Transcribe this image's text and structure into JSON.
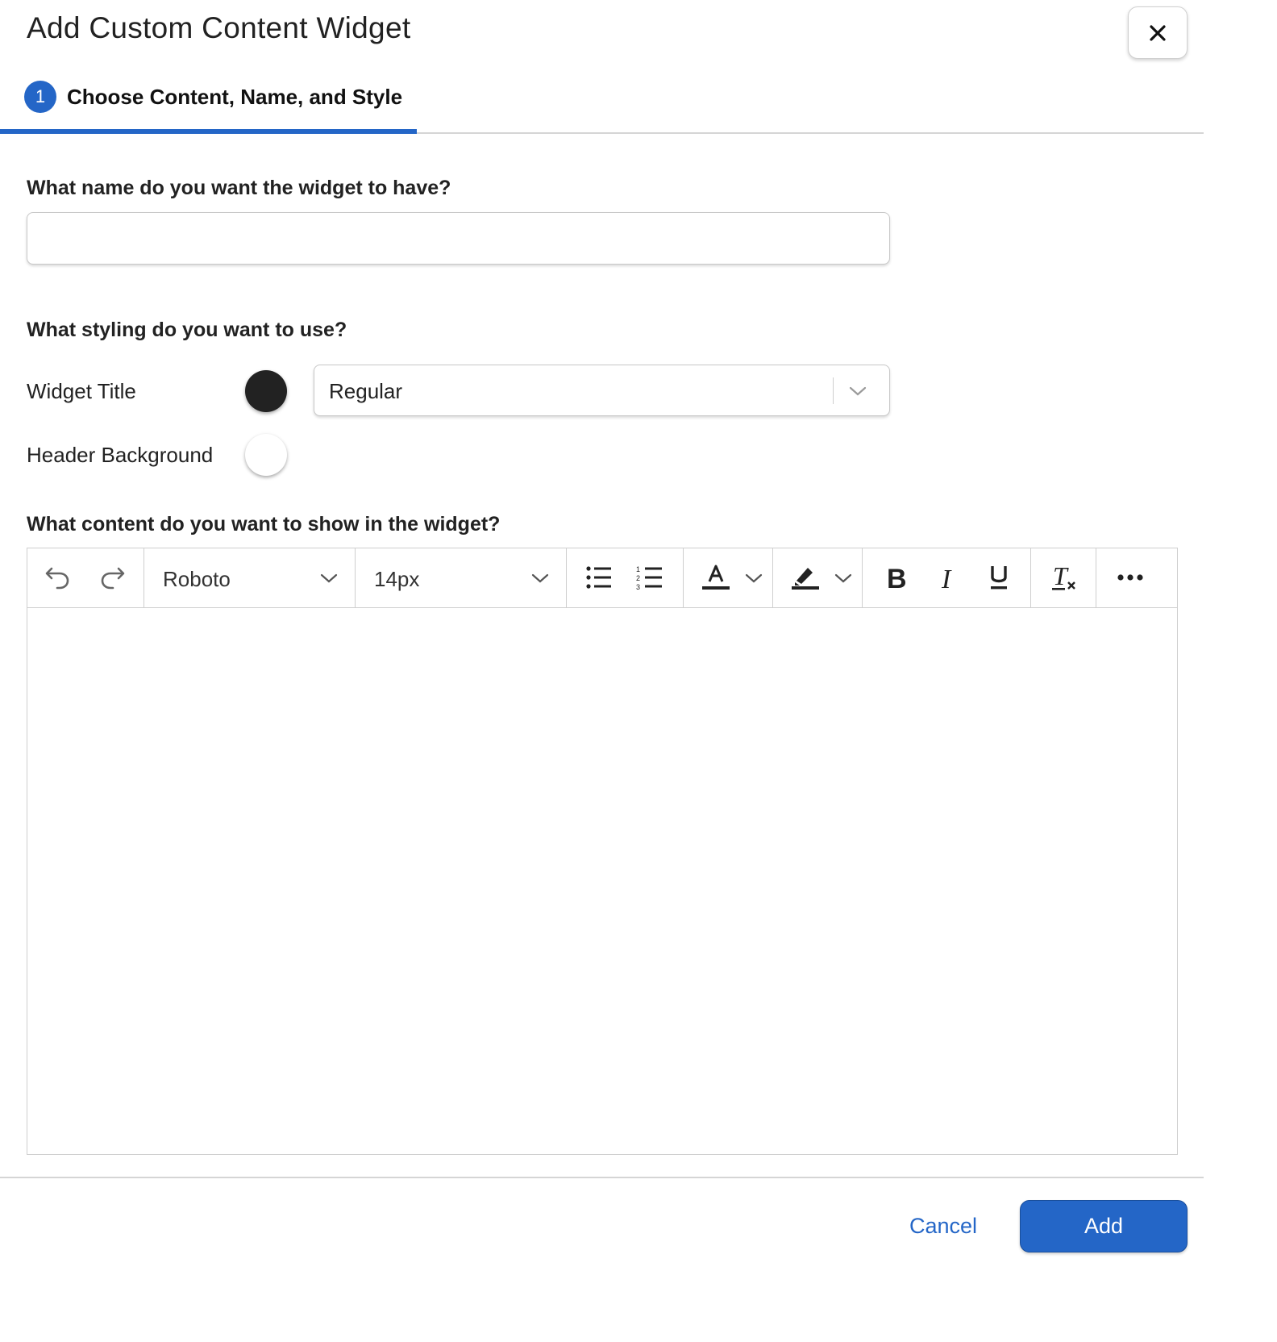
{
  "dialog": {
    "title": "Add Custom Content Widget",
    "close_icon": "close-icon"
  },
  "tabs": [
    {
      "step": "1",
      "label": "Choose Content, Name, and Style",
      "active": true
    }
  ],
  "name_section": {
    "label": "What name do you want the widget to have?",
    "value": "",
    "placeholder": ""
  },
  "styling_section": {
    "label": "What styling do you want to use?",
    "widget_title": {
      "label": "Widget Title",
      "color": "#222222",
      "weight": "Regular"
    },
    "header_background": {
      "label": "Header Background",
      "color": "#ffffff"
    }
  },
  "content_section": {
    "label": "What content do you want to show in the widget?",
    "toolbar": {
      "font_family": "Roboto",
      "font_size": "14px",
      "icons": [
        "undo-icon",
        "redo-icon",
        "bulleted-list-icon",
        "numbered-list-icon",
        "text-color-icon",
        "highlight-icon",
        "bold-icon",
        "italic-icon",
        "underline-icon",
        "clear-format-icon",
        "more-icon"
      ]
    },
    "body": ""
  },
  "footer": {
    "cancel_label": "Cancel",
    "add_label": "Add"
  },
  "colors": {
    "accent": "#2466c7"
  }
}
